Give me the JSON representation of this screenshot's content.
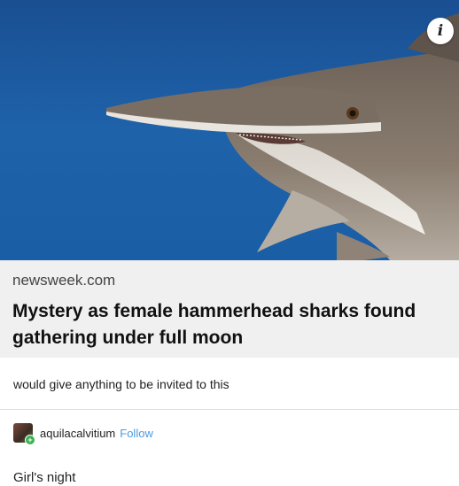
{
  "post": {
    "info_icon": "info-icon",
    "link": {
      "domain": "newsweek.com",
      "title": "Mystery as female hammerhead sharks found gathering under full moon"
    },
    "reblog_comment": "would give anything to be invited to this",
    "author": {
      "username": "aquilacalvitium",
      "follow_label": "Follow",
      "avatar_icon": "avatar-image",
      "badge_icon": "plus-badge-icon"
    },
    "reply_text": "Girl's night"
  },
  "colors": {
    "water": "#1d5fa6",
    "link_box_bg": "#f0f0f0",
    "follow_link": "#4a9be0",
    "divider": "#dcdcdc"
  }
}
